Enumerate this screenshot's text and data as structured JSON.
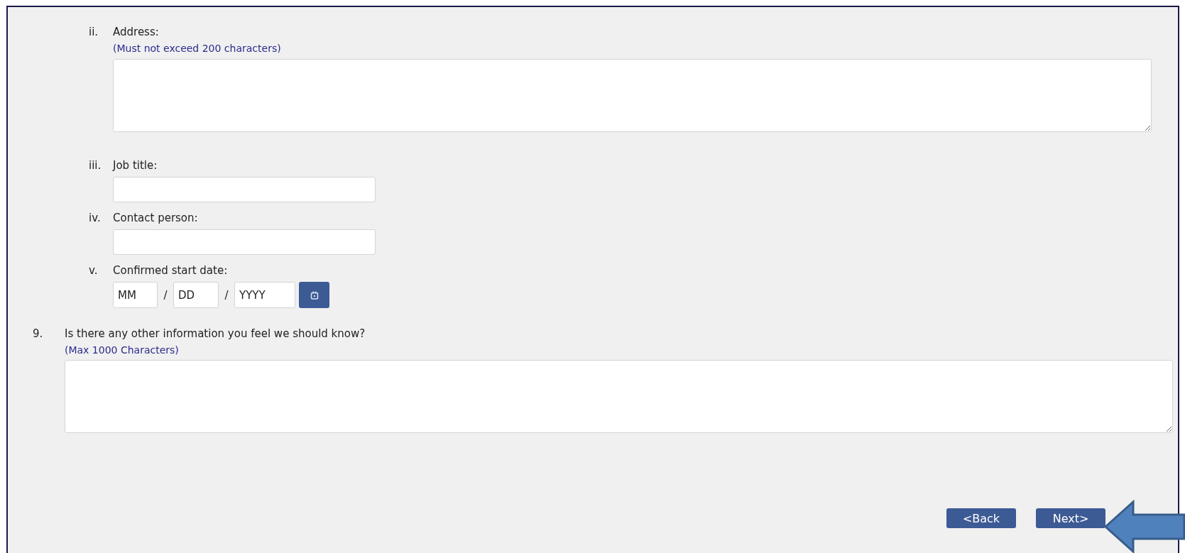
{
  "sub_items": [
    {
      "marker": "ii.",
      "label": "Address:",
      "hint": "(Must not exceed 200 characters)",
      "kind": "textarea"
    },
    {
      "marker": "iii.",
      "label": "Job title:",
      "kind": "text"
    },
    {
      "marker": "iv.",
      "label": "Contact person:",
      "kind": "text"
    },
    {
      "marker": "v.",
      "label": "Confirmed start date:",
      "kind": "date",
      "date_fields": [
        {
          "placeholder": "MM",
          "separator": "/"
        },
        {
          "placeholder": "DD",
          "separator": "/"
        },
        {
          "placeholder": "YYYY"
        }
      ]
    }
  ],
  "question": {
    "number": "9.",
    "label": "Is there any other information you feel we should know?",
    "hint": "(Max 1000 Characters)"
  },
  "buttons": [
    {
      "label": "<Back"
    },
    {
      "label": "Next>"
    }
  ]
}
